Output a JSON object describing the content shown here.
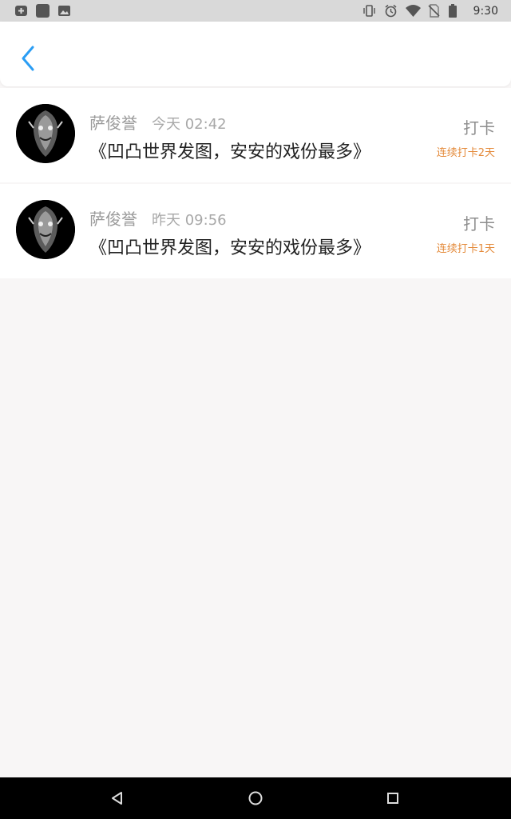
{
  "status_bar": {
    "time": "9:30",
    "left_icons": [
      "plus-box-icon",
      "app-square-icon",
      "image-icon"
    ],
    "right_icons": [
      "vibrate-icon",
      "alarm-icon",
      "wifi-icon",
      "no-sim-icon",
      "battery-icon"
    ]
  },
  "header": {
    "back_icon": "chevron-left-icon",
    "accent_color": "#2a9df4"
  },
  "feed": {
    "items": [
      {
        "username": "萨俊誉",
        "time": "今天 02:42",
        "book": "《凹凸世界发图，安安的戏份最多》",
        "checkin_label": "打卡",
        "streak": "连续打卡2天"
      },
      {
        "username": "萨俊誉",
        "time": "昨天 09:56",
        "book": "《凹凸世界发图，安安的戏份最多》",
        "checkin_label": "打卡",
        "streak": "连续打卡1天"
      }
    ]
  },
  "colors": {
    "streak": "#e48a3a",
    "background": "#f8f6f6"
  },
  "nav_bar": {
    "buttons": [
      "back-triangle-icon",
      "home-circle-icon",
      "recents-square-icon"
    ]
  }
}
